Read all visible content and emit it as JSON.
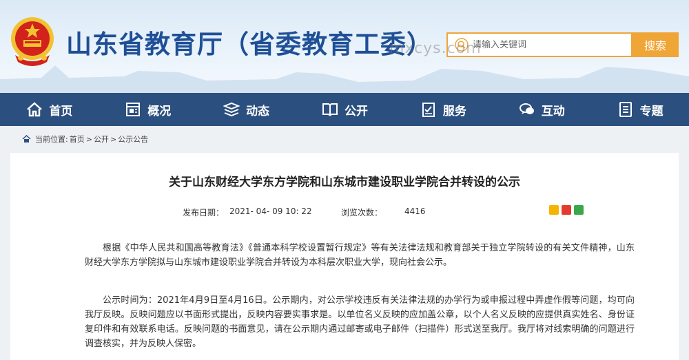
{
  "header": {
    "site_title": "山东省教育厅（省委教育工委）",
    "search_placeholder": "请输入关键词",
    "search_button": "搜索",
    "watermark": "mxcys.com"
  },
  "nav": {
    "items": [
      {
        "label": "首页",
        "icon": "home-icon"
      },
      {
        "label": "概况",
        "icon": "overview-icon"
      },
      {
        "label": "动态",
        "icon": "news-icon"
      },
      {
        "label": "公开",
        "icon": "book-icon"
      },
      {
        "label": "服务",
        "icon": "service-icon"
      },
      {
        "label": "互动",
        "icon": "chat-icon"
      },
      {
        "label": "专题",
        "icon": "topic-icon"
      }
    ]
  },
  "breadcrumb": {
    "prefix": "当前位置:",
    "items": [
      "首页",
      "公开",
      "公示公告"
    ],
    "separator": ">"
  },
  "article": {
    "title": "关于山东财经大学东方学院和山东城市建设职业学院合并转设的公示",
    "date_label": "发布日期：",
    "date_value": "2021- 04- 09 10: 22",
    "views_label": "浏览次数：",
    "views_value": "4416",
    "paragraphs": [
      "根据《中华人民共和国高等教育法》《普通本科学校设置暂行规定》等有关法律法规和教育部关于独立学院转设的有关文件精神，山东财经大学东方学院拟与山东城市建设职业学院合并转设为本科层次职业大学，现向社会公示。",
      "公示时间为：2021年4月9日至4月16日。公示期内，对公示学校违反有关法律法规的办学行为或申报过程中弄虚作假等问题，均可向我厅反映。反映问题应以书面形式提出，反映内容要实事求是。以单位名义反映的应加盖公章，以个人名义反映的应提供真实姓名、身份证复印件和有效联系电话。反映问题的书面意见，请在公示期内通过邮寄或电子邮件（扫描件）形式送至我厅。我厅将对线索明确的问题进行调查核实，并为反映人保密。"
    ]
  },
  "colors": {
    "title_blue": "#1f4f96",
    "nav_bg": "#2b4f7e",
    "search_accent": "#f0a537"
  }
}
